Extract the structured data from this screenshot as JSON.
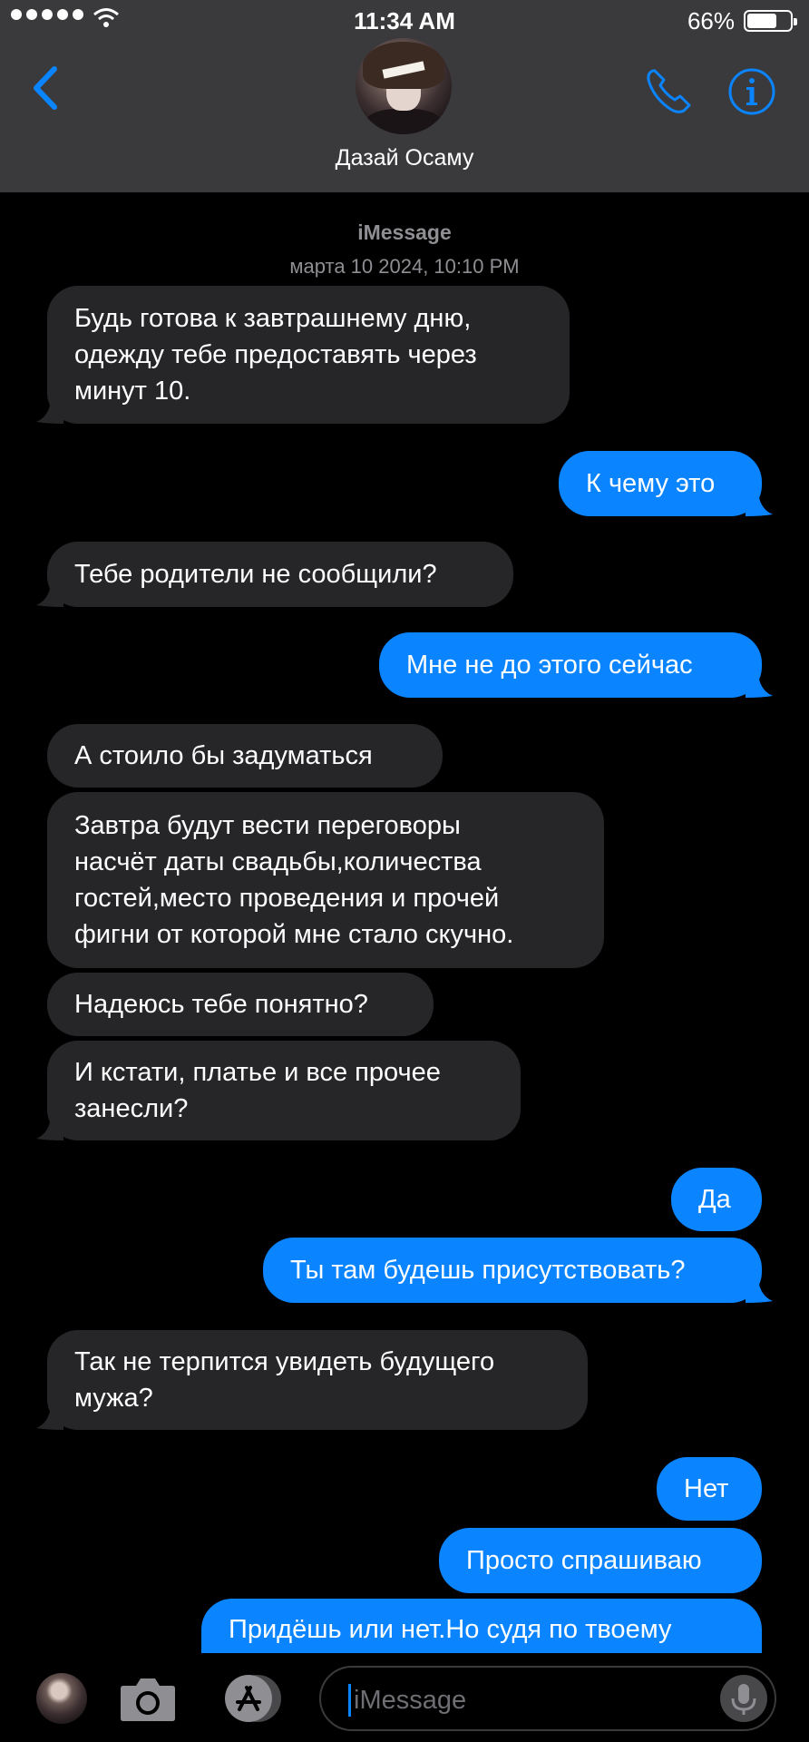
{
  "status_bar": {
    "time": "11:34 AM",
    "battery_percent": "66%",
    "battery_level": 0.66,
    "signal_bars": 5,
    "wifi": "wifi-icon"
  },
  "header": {
    "contact_name": "Дазай Осаму",
    "back_icon": "chevron-left-icon",
    "phone_icon": "phone-icon",
    "info_icon": "info-icon",
    "accent_color": "#0a84ff"
  },
  "conversation": {
    "service": "iMessage",
    "date": "марта 10 2024, 10:10 PM"
  },
  "messages": [
    {
      "from": "contact",
      "text": "Будь готова к завтрашнему дню,\nодежду тебе предоставять через\nминут 10."
    },
    {
      "from": "me",
      "text": "К чему это"
    },
    {
      "from": "contact",
      "text": "Тебе родители не сообщили?"
    },
    {
      "from": "me",
      "text": "Мне не до этого сейчас"
    },
    {
      "from": "contact",
      "text": "А стоило бы задуматься"
    },
    {
      "from": "contact",
      "text": "Завтра будут вести переговоры\nнасчёт даты свадьбы,количества\nгостей,место проведения и прочей\nфигни от которой мне стало скучно."
    },
    {
      "from": "contact",
      "text": "Надеюсь тебе понятно?"
    },
    {
      "from": "contact",
      "text": "И кстати, платье и все прочее\nзанесли?"
    },
    {
      "from": "me",
      "text": "Да"
    },
    {
      "from": "me",
      "text": "Ты там будешь присутствовать?"
    },
    {
      "from": "contact",
      "text": "Так не терпится увидеть будущего\nмужа?"
    },
    {
      "from": "me",
      "text": "Нет"
    },
    {
      "from": "me",
      "text": "Просто спрашиваю"
    },
    {
      "from": "me",
      "text": "Придёшь или нет.Но судя по твоему"
    }
  ],
  "input_bar": {
    "placeholder": "iMessage",
    "camera_icon": "camera-icon",
    "appstore_icon": "app-store-icon",
    "mic_icon": "microphone-icon"
  },
  "colors": {
    "incoming_bubble": "#262629",
    "outgoing_bubble": "#0a84ff",
    "header_bg": "#3a3a3c"
  }
}
